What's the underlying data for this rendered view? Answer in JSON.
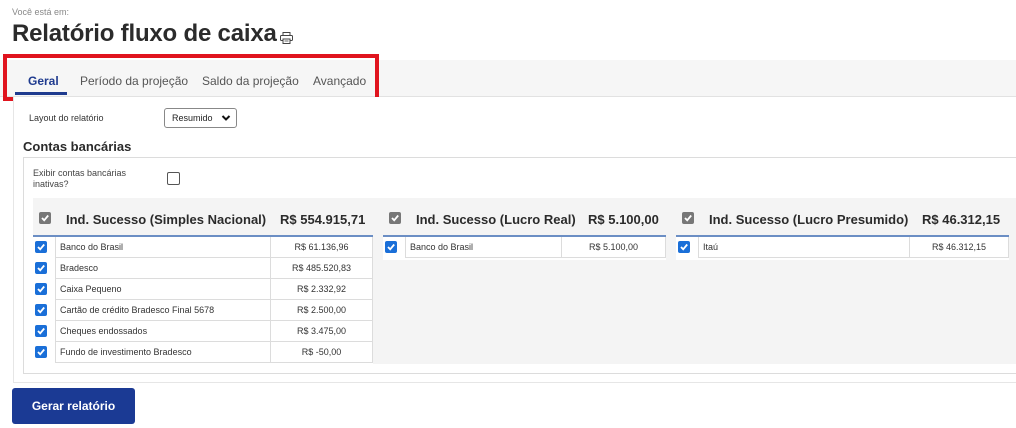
{
  "header": {
    "breadcrumb": "Você está em:",
    "title": "Relatório fluxo de caixa",
    "print_icon": "print-icon"
  },
  "tabs": [
    {
      "label": "Geral",
      "active": true
    },
    {
      "label": "Período da projeção",
      "active": false
    },
    {
      "label": "Saldo da projeção",
      "active": false
    },
    {
      "label": "Avançado",
      "active": false
    }
  ],
  "layout": {
    "label": "Layout do relatório",
    "selected": "Resumido"
  },
  "contas": {
    "title": "Contas bancárias",
    "inactive_label": "Exibir contas bancárias inativas?",
    "inactive_checked": false
  },
  "groups": [
    {
      "name": "Ind. Sucesso (Simples Nacional)",
      "total": "R$ 554.915,71",
      "accounts": [
        {
          "name": "Banco do Brasil",
          "value": "R$ 61.136,96"
        },
        {
          "name": "Bradesco",
          "value": "R$ 485.520,83"
        },
        {
          "name": "Caixa Pequeno",
          "value": "R$ 2.332,92"
        },
        {
          "name": "Cartão de crédito Bradesco Final 5678",
          "value": "R$ 2.500,00"
        },
        {
          "name": "Cheques endossados",
          "value": "R$ 3.475,00"
        },
        {
          "name": "Fundo de investimento Bradesco",
          "value": "R$ -50,00"
        }
      ]
    },
    {
      "name": "Ind. Sucesso (Lucro Real)",
      "total": "R$ 5.100,00",
      "accounts": [
        {
          "name": "Banco do Brasil",
          "value": "R$ 5.100,00"
        }
      ]
    },
    {
      "name": "Ind. Sucesso (Lucro Presumido)",
      "total": "R$ 46.312,15",
      "accounts": [
        {
          "name": "Itaú",
          "value": "R$ 46.312,15"
        }
      ]
    }
  ],
  "actions": {
    "generate_label": "Gerar relatório"
  },
  "colors": {
    "primary": "#1b3a94",
    "checkbox": "#1a6fd8",
    "highlight": "#e0141e"
  }
}
